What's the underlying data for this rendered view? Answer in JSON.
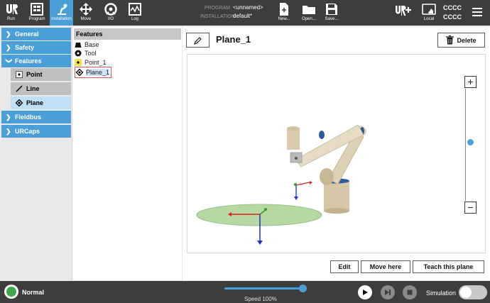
{
  "topbar": {
    "tabs": [
      {
        "label": "Run",
        "icon": "ur-logo-icon"
      },
      {
        "label": "Program",
        "icon": "program-icon"
      },
      {
        "label": "Installation",
        "icon": "installation-icon",
        "active": true
      },
      {
        "label": "Move",
        "icon": "move-icon"
      },
      {
        "label": "I/O",
        "icon": "io-icon"
      },
      {
        "label": "Log",
        "icon": "log-icon"
      }
    ],
    "program_key": "PROGRAM",
    "program_value": "<unnamed>",
    "installation_key": "INSTALLATION",
    "installation_value": "default*",
    "file_buttons": [
      {
        "label": "New...",
        "icon": "new-file-icon"
      },
      {
        "label": "Open...",
        "icon": "folder-icon"
      },
      {
        "label": "Save...",
        "icon": "save-icon"
      }
    ],
    "local_label": "Local",
    "user_line1": "CCCC",
    "user_line2": "CCCC"
  },
  "leftnav": {
    "items": [
      {
        "label": "General",
        "expanded": false
      },
      {
        "label": "Safety",
        "expanded": false
      },
      {
        "label": "Features",
        "expanded": true
      },
      {
        "label": "Fieldbus",
        "expanded": false
      },
      {
        "label": "URCaps",
        "expanded": false
      }
    ],
    "feature_subitems": [
      {
        "label": "Point",
        "icon": "point-icon"
      },
      {
        "label": "Line",
        "icon": "line-icon"
      },
      {
        "label": "Plane",
        "icon": "plane-icon",
        "selected": true
      }
    ]
  },
  "tree": {
    "header": "Features",
    "items": [
      {
        "label": "Base",
        "icon": "base-icon"
      },
      {
        "label": "Tool",
        "icon": "tool-icon"
      },
      {
        "label": "Point_1",
        "icon": "point-icon"
      },
      {
        "label": "Plane_1",
        "icon": "plane-icon",
        "selected": true
      }
    ]
  },
  "main": {
    "feature_name": "Plane_1",
    "delete_label": "Delete",
    "edit_label": "Edit",
    "move_here_label": "Move here",
    "teach_label": "Teach this plane",
    "zoom_in": "+",
    "zoom_out": "−"
  },
  "footer": {
    "status": "Normal",
    "speed_label": "Speed 100%",
    "speed_fraction": 1.0,
    "simulation_label": "Simulation",
    "simulation_on": false
  },
  "colors": {
    "topbar": "#3d3d3d",
    "accent": "#4a9fd8",
    "status_ok": "#3caa4a",
    "plane_fill": "#b7d8a3"
  }
}
